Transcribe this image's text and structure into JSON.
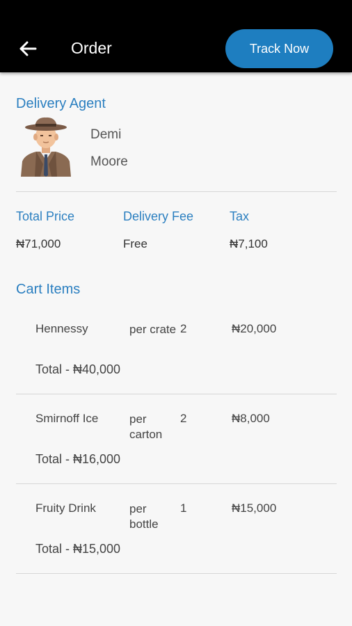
{
  "header": {
    "title": "Order",
    "back_icon": "arrow-left-icon",
    "track_label": "Track Now",
    "accent": "#1e7ec0"
  },
  "agent": {
    "section_title": "Delivery Agent",
    "first_name": "Demi",
    "last_name": "Moore",
    "avatar_icon": "detective-avatar-icon"
  },
  "summary": {
    "total_price_label": "Total Price",
    "total_price_value": "₦71,000",
    "delivery_fee_label": "Delivery Fee",
    "delivery_fee_value": "Free",
    "tax_label": "Tax",
    "tax_value": "₦7,100"
  },
  "cart": {
    "section_title": "Cart Items",
    "items": [
      {
        "name": "Hennessy",
        "unit": "per crate",
        "qty": "2",
        "price": "₦20,000",
        "total": "Total - ₦40,000"
      },
      {
        "name": "Smirnoff Ice",
        "unit": "per carton",
        "qty": "2",
        "price": "₦8,000",
        "total": "Total - ₦16,000"
      },
      {
        "name": "Fruity Drink",
        "unit": "per bottle",
        "qty": "1",
        "price": "₦15,000",
        "total": "Total - ₦15,000"
      }
    ]
  }
}
